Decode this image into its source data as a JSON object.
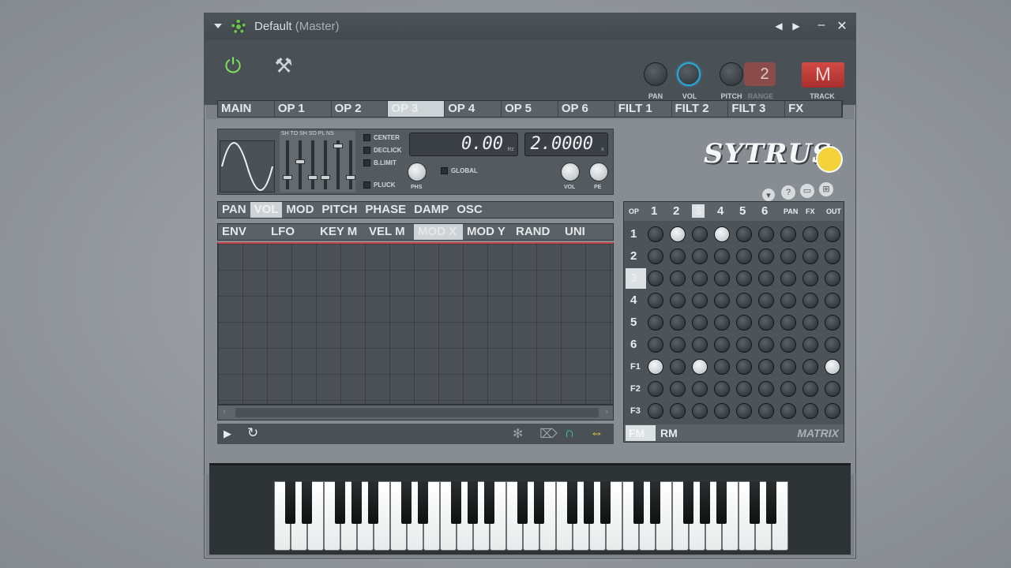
{
  "window": {
    "title": "Default",
    "subtitle": "(Master)",
    "prev_label": "◀",
    "next_label": "▶",
    "minimize_label": "–",
    "close_label": "✕"
  },
  "top": {
    "pan_label": "PAN",
    "vol_label": "VOL",
    "pitch_label": "PITCH",
    "range_label": "RANGE",
    "range_value": "2",
    "track_label": "TRACK",
    "track_value": "M"
  },
  "main_tabs": [
    "MAIN",
    "OP 1",
    "OP 2",
    "OP 3",
    "OP 4",
    "OP 5",
    "OP 6",
    "FILT 1",
    "FILT 2",
    "FILT 3",
    "FX"
  ],
  "main_tab_active": "OP 3",
  "osc": {
    "slider_labels": "SH TO SH SO PL NS",
    "center_label": "CENTER",
    "declick_label": "DECLICK",
    "blimit_label": "B.LIMIT",
    "pluck_label": "PLUCK",
    "global_label": "GLOBAL",
    "freq_value": "0.00",
    "freq_unit": "Hz",
    "ratio_value": "2.0000",
    "ratio_unit": "x",
    "phs_label": "PHS",
    "vol_label": "VOL",
    "pe_label": "PE"
  },
  "logo": {
    "text": "SYTRUS"
  },
  "sub_tabs": [
    "PAN",
    "VOL",
    "MOD",
    "PITCH",
    "PHASE",
    "DAMP",
    "OSC"
  ],
  "sub_tab_active": "VOL",
  "env_tabs": [
    "ENV",
    "LFO",
    "KEY M",
    "VEL M",
    "MOD X",
    "MOD Y",
    "RAND",
    "UNI"
  ],
  "env_tab_active": "MOD X",
  "matrix": {
    "corner_label": "OP",
    "columns": [
      "1",
      "2",
      "3",
      "4",
      "5",
      "6",
      "PAN",
      "FX",
      "OUT"
    ],
    "rows": [
      "1",
      "2",
      "3",
      "4",
      "5",
      "6",
      "F1",
      "F2",
      "F3"
    ],
    "fm_label": "FM",
    "rm_label": "RM",
    "title_label": "MATRIX"
  },
  "icons": {
    "plug": "plug-icon",
    "wrench": "wrench-icon",
    "play": "play-icon",
    "loop": "loop-icon",
    "snowflake": "snowflake-icon",
    "tag": "tag-icon",
    "magnet": "magnet-icon",
    "arrows": "arrows-icon"
  },
  "colors": {
    "accent_green": "#7fe05a",
    "knob_blue": "#2aa8d8",
    "track_red": "#c0403c",
    "envelope_red": "#c5464a"
  }
}
